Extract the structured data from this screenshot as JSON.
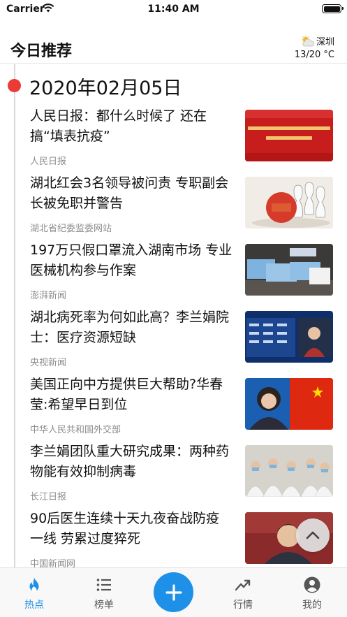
{
  "status_bar": {
    "carrier": "Carrier",
    "time": "11:40 AM"
  },
  "header": {
    "title": "今日推荐",
    "weather": {
      "city": "深圳",
      "temp": "13/20 °C",
      "icon": "partly-cloudy-icon"
    }
  },
  "feed": {
    "date": "2020年02月05日",
    "items": [
      {
        "title": "人民日报：都什么时候了 还在搞“填表抗疫”",
        "source": "人民日报",
        "thumb": "red-banner-thumbnail"
      },
      {
        "title": "湖北红会3名领导被问责 专职副会长被免职并警告",
        "source": "湖北省纪委监委网站",
        "thumb": "accountability-cartoon-thumbnail"
      },
      {
        "title": "197万只假口罩流入湖南市场 专业医械机构参与作案",
        "source": "澎湃新闻",
        "thumb": "face-masks-thumbnail"
      },
      {
        "title": "湖北病死率为何如此高？李兰娟院士：医疗资源短缺",
        "source": "央视新闻",
        "thumb": "news-broadcast-thumbnail"
      },
      {
        "title": "美国正向中方提供巨大帮助?华春莹:希望早日到位",
        "source": "中华人民共和国外交部",
        "thumb": "spokesperson-flag-thumbnail"
      },
      {
        "title": "李兰娟团队重大研究成果：两种药物能有效抑制病毒",
        "source": "长江日报",
        "thumb": "medical-team-thumbnail"
      },
      {
        "title": "90后医生连续十天九夜奋战防疫一线 劳累过度猝死",
        "source": "中国新闻网",
        "thumb": "doctor-portrait-thumbnail"
      }
    ]
  },
  "tab_bar": {
    "tabs": [
      {
        "label": "热点",
        "icon": "flame-icon",
        "active": true
      },
      {
        "label": "榜单",
        "icon": "list-icon",
        "active": false
      },
      {
        "label": "行情",
        "icon": "trend-icon",
        "active": false
      },
      {
        "label": "我的",
        "icon": "profile-icon",
        "active": false
      }
    ],
    "center_button_icon": "plus-icon"
  },
  "colors": {
    "accent": "#1e90e8",
    "timeline_dot": "#ec3b36",
    "source_text": "#8c8c8c"
  }
}
